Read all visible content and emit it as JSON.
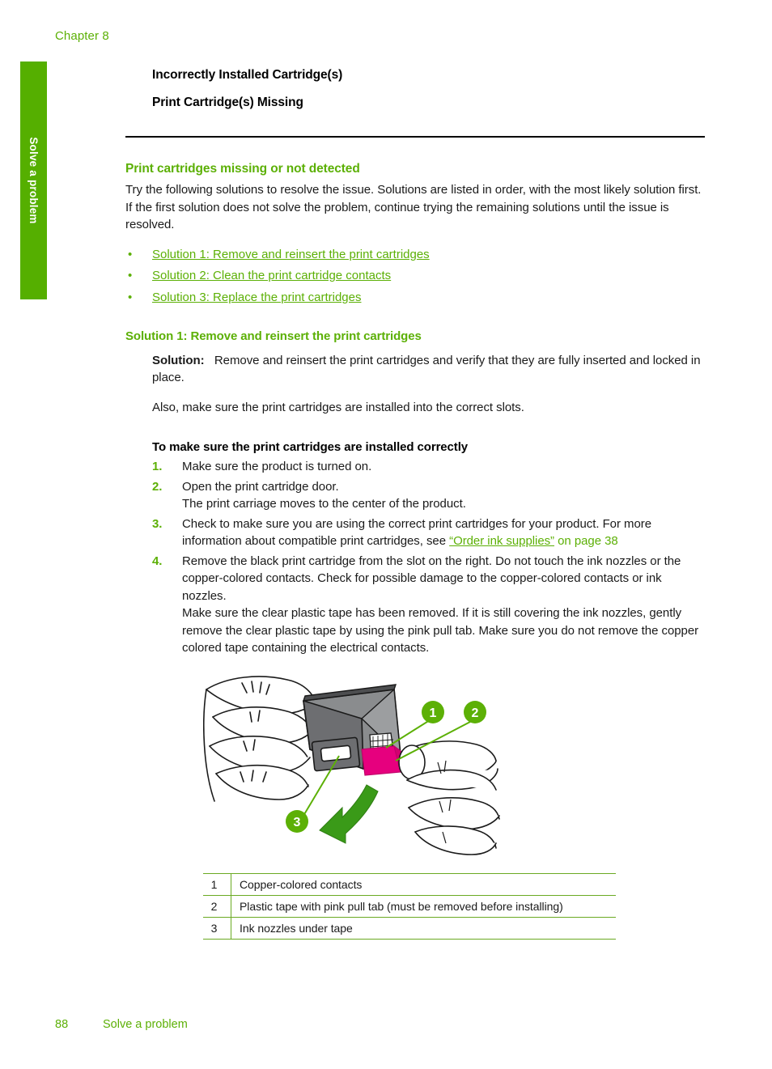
{
  "running_head": {
    "chapter": "Chapter 8"
  },
  "side_tab": {
    "label": "Solve a problem",
    "color": "#55af00"
  },
  "colors": {
    "accent_green": "#5cb006",
    "rule_black": "#000000",
    "table_line": "#6aaa22",
    "pink_tab": "#e6007e",
    "cartridge_gray": "#6d6e71"
  },
  "messages": {
    "incorrect": "Incorrectly Installed Cartridge(s)",
    "missing": "Print Cartridge(s) Missing"
  },
  "section": {
    "heading": "Print cartridges missing or not detected",
    "intro": "Try the following solutions to resolve the issue. Solutions are listed in order, with the most likely solution first. If the first solution does not solve the problem, continue trying the remaining solutions until the issue is resolved.",
    "bullet": "•",
    "links": [
      {
        "label": "Solution 1: Remove and reinsert the print cartridges"
      },
      {
        "label": "Solution 2: Clean the print cartridge contacts"
      },
      {
        "label": "Solution 3: Replace the print cartridges"
      }
    ]
  },
  "solution1": {
    "heading": "Solution 1: Remove and reinsert the print cartridges",
    "solution_label": "Solution:",
    "solution_text": "Remove and reinsert the print cartridges and verify that they are fully inserted and locked in place.",
    "also_text": "Also, make sure the print cartridges are installed into the correct slots.",
    "procedure_title": "To make sure the print cartridges are installed correctly",
    "steps": [
      {
        "num": "1.",
        "text": "Make sure the product is turned on.",
        "sub": ""
      },
      {
        "num": "2.",
        "text": "Open the print cartridge door.",
        "sub": "The print carriage moves to the center of the product."
      },
      {
        "num": "3.",
        "text": "Check to make sure you are using the correct print cartridges for your product. For more information about compatible print cartridges, see ",
        "link_text": "“Order ink supplies”",
        "link_tail": " on page 38",
        "sub": ""
      },
      {
        "num": "4.",
        "text": "Remove the black print cartridge from the slot on the right. Do not touch the ink nozzles or the copper-colored contacts. Check for possible damage to the copper-colored contacts or ink nozzles.",
        "sub": "Make sure the clear plastic tape has been removed. If it is still covering the ink nozzles, gently remove the clear plastic tape by using the pink pull tab. Make sure you do not remove the copper colored tape containing the electrical contacts."
      }
    ]
  },
  "figure": {
    "alt": "Hands holding a print cartridge showing contacts, pink pull tab and ink nozzles",
    "callouts": [
      {
        "id": "1"
      },
      {
        "id": "2"
      },
      {
        "id": "3"
      }
    ]
  },
  "legend": {
    "rows": [
      {
        "idx": "1",
        "desc": "Copper-colored contacts"
      },
      {
        "idx": "2",
        "desc": "Plastic tape with pink pull tab (must be removed before installing)"
      },
      {
        "idx": "3",
        "desc": "Ink nozzles under tape"
      }
    ]
  },
  "footer": {
    "page_number": "88",
    "section_name": "Solve a problem"
  }
}
